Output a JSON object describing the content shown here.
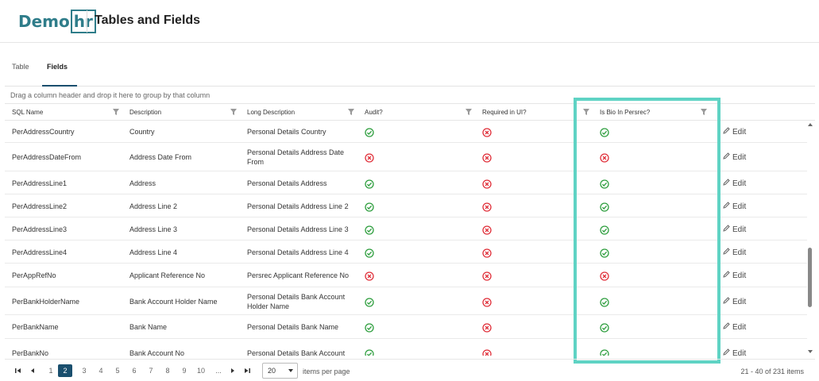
{
  "app": {
    "logo_text": "Demo",
    "logo_box_text": "hr",
    "page_title": "Tables and Fields"
  },
  "tabs": [
    {
      "label": "Table",
      "active": false
    },
    {
      "label": "Fields",
      "active": true
    }
  ],
  "group_hint": "Drag a column header and drop it here to group by that column",
  "columns": [
    {
      "label": "SQL Name"
    },
    {
      "label": "Description"
    },
    {
      "label": "Long Description"
    },
    {
      "label": "Audit?"
    },
    {
      "label": "Required in UI?"
    },
    {
      "label": "Is Bio In Persrec?"
    }
  ],
  "rows": [
    {
      "sql": "PerAddressCountry",
      "desc": "Country",
      "long": "Personal Details Country",
      "audit": true,
      "required": false,
      "bio": true,
      "edit": "Edit"
    },
    {
      "sql": "PerAddressDateFrom",
      "desc": "Address Date From",
      "long": "Personal Details Address Date From",
      "audit": false,
      "required": false,
      "bio": false,
      "edit": "Edit"
    },
    {
      "sql": "PerAddressLine1",
      "desc": "Address",
      "long": "Personal Details Address",
      "audit": true,
      "required": false,
      "bio": true,
      "edit": "Edit"
    },
    {
      "sql": "PerAddressLine2",
      "desc": "Address Line 2",
      "long": "Personal Details Address Line 2",
      "audit": true,
      "required": false,
      "bio": true,
      "edit": "Edit"
    },
    {
      "sql": "PerAddressLine3",
      "desc": "Address Line 3",
      "long": "Personal Details Address Line 3",
      "audit": true,
      "required": false,
      "bio": true,
      "edit": "Edit"
    },
    {
      "sql": "PerAddressLine4",
      "desc": "Address Line 4",
      "long": "Personal Details Address Line 4",
      "audit": true,
      "required": false,
      "bio": true,
      "edit": "Edit"
    },
    {
      "sql": "PerAppRefNo",
      "desc": "Applicant Reference No",
      "long": "Persrec Applicant Reference No",
      "audit": false,
      "required": false,
      "bio": false,
      "edit": "Edit"
    },
    {
      "sql": "PerBankHolderName",
      "desc": "Bank Account Holder Name",
      "long": "Personal Details Bank Account Holder Name",
      "audit": true,
      "required": false,
      "bio": true,
      "edit": "Edit"
    },
    {
      "sql": "PerBankName",
      "desc": "Bank Name",
      "long": "Personal Details Bank Name",
      "audit": true,
      "required": false,
      "bio": true,
      "edit": "Edit"
    },
    {
      "sql": "PerBankNo",
      "desc": "Bank Account No",
      "long": "Personal Details Bank Account",
      "audit": true,
      "required": false,
      "bio": true,
      "edit": "Edit"
    }
  ],
  "pager": {
    "pages": [
      "1",
      "2",
      "3",
      "4",
      "5",
      "6",
      "7",
      "8",
      "9",
      "10",
      "..."
    ],
    "current": "2",
    "page_size": "20",
    "items_per_page_label": "items per page",
    "range_text": "21 - 40 of 231 items"
  },
  "colors": {
    "accent": "#1a4f6e",
    "check": "#2e9e3e",
    "cross": "#e0303a",
    "highlight": "#5fd3c4"
  }
}
